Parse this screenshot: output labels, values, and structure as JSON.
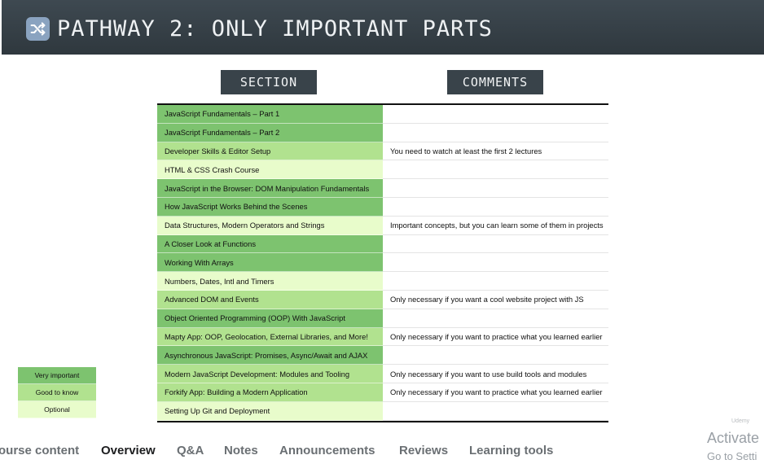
{
  "slide": {
    "title": "PATHWAY 2: ONLY IMPORTANT PARTS",
    "icon": "shuffle-icon",
    "header_color": "#323c42",
    "column_headers": {
      "section": "SECTION",
      "comments": "COMMENTS"
    },
    "rows": [
      {
        "section": "JavaScript Fundamentals – Part 1",
        "comment": "",
        "level": "very"
      },
      {
        "section": "JavaScript Fundamentals – Part 2",
        "comment": "",
        "level": "very"
      },
      {
        "section": "Developer Skills & Editor Setup",
        "comment": "You need to watch at least the first 2 lectures",
        "level": "good"
      },
      {
        "section": "HTML & CSS Crash Course",
        "comment": "",
        "level": "opt"
      },
      {
        "section": "JavaScript in the Browser: DOM Manipulation Fundamentals",
        "comment": "",
        "level": "very"
      },
      {
        "section": "How JavaScript Works Behind the Scenes",
        "comment": "",
        "level": "very"
      },
      {
        "section": "Data Structures, Modern Operators and Strings",
        "comment": "Important concepts, but you can learn some of them in projects",
        "level": "opt"
      },
      {
        "section": "A Closer Look at Functions",
        "comment": "",
        "level": "very"
      },
      {
        "section": "Working With Arrays",
        "comment": "",
        "level": "very"
      },
      {
        "section": "Numbers, Dates, Intl and Timers",
        "comment": "",
        "level": "opt"
      },
      {
        "section": "Advanced DOM and Events",
        "comment": "Only necessary if you want a cool website project with JS",
        "level": "good"
      },
      {
        "section": "Object Oriented Programming (OOP) With JavaScript",
        "comment": "",
        "level": "very"
      },
      {
        "section": "Mapty App: OOP, Geolocation, External Libraries, and More!",
        "comment": "Only necessary if you want to practice what you learned earlier",
        "level": "good"
      },
      {
        "section": "Asynchronous JavaScript: Promises, Async/Await and AJAX",
        "comment": "",
        "level": "very"
      },
      {
        "section": "Modern JavaScript Development: Modules and Tooling",
        "comment": "Only necessary if you want to use build tools and modules",
        "level": "good"
      },
      {
        "section": "Forkify App: Building a Modern Application",
        "comment": "Only necessary if you want to practice what you learned earlier",
        "level": "good"
      },
      {
        "section": "Setting Up Git and Deployment",
        "comment": "",
        "level": "opt"
      }
    ],
    "legend": [
      {
        "label": "Very important",
        "level": "very"
      },
      {
        "label": "Good to know",
        "level": "good"
      },
      {
        "label": "Optional",
        "level": "opt"
      }
    ],
    "level_colors": {
      "very": "#7dc36f",
      "good": "#b1e28f",
      "opt": "#e8fccb"
    },
    "watermark": "Udemy"
  },
  "tabs": [
    {
      "label": "ourse content",
      "active": false
    },
    {
      "label": "Overview",
      "active": true
    },
    {
      "label": "Q&A",
      "active": false
    },
    {
      "label": "Notes",
      "active": false
    },
    {
      "label": "Announcements",
      "active": false
    },
    {
      "label": "Reviews",
      "active": false
    },
    {
      "label": "Learning tools",
      "active": false
    }
  ],
  "windows_notice": {
    "title": "Activate",
    "subtitle": "Go to Setti"
  }
}
